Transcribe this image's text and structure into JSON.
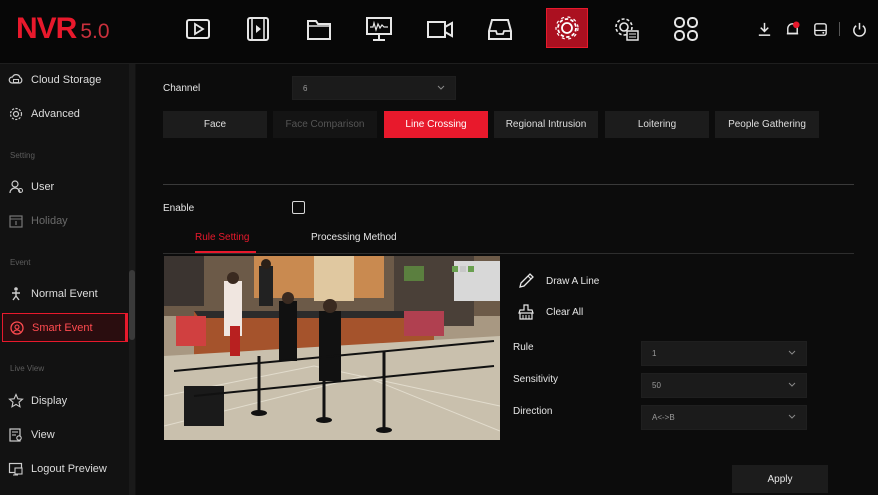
{
  "header": {
    "logo_main": "NVR",
    "logo_version": "5.0",
    "nav_icons": [
      "playback-icon",
      "video-clip-icon",
      "folder-icon",
      "monitor-icon",
      "camera-icon",
      "storage-icon",
      "settings-gear-icon",
      "system-config-icon",
      "grid-menu-icon"
    ],
    "active_nav": "settings-gear-icon",
    "right_icons": [
      "download-icon",
      "alarm-bell-icon",
      "disk-icon",
      "power-icon"
    ]
  },
  "sidebar": {
    "items": [
      {
        "label": "Cloud Storage",
        "icon": "cloud-storage-icon",
        "state": "normal"
      },
      {
        "label": "Advanced",
        "icon": "advanced-gear-icon",
        "state": "normal"
      },
      {
        "label": "User",
        "icon": "user-icon",
        "state": "normal"
      },
      {
        "label": "Holiday",
        "icon": "calendar-icon",
        "state": "dim"
      },
      {
        "label": "Normal Event",
        "icon": "person-walking-icon",
        "state": "normal"
      },
      {
        "label": "Smart Event",
        "icon": "smart-event-icon",
        "state": "active"
      },
      {
        "label": "Display",
        "icon": "star-icon",
        "state": "normal"
      },
      {
        "label": "View",
        "icon": "view-icon",
        "state": "normal"
      },
      {
        "label": "Logout Preview",
        "icon": "logout-preview-icon",
        "state": "normal"
      }
    ],
    "sections": {
      "setting": "Setting",
      "event": "Event",
      "live_view": "Live View"
    }
  },
  "main": {
    "channel_label": "Channel",
    "channel_value": "6",
    "tabs": [
      {
        "label": "Face",
        "state": "normal"
      },
      {
        "label": "Face Comparison",
        "state": "disabled"
      },
      {
        "label": "Line Crossing",
        "state": "active"
      },
      {
        "label": "Regional Intrusion",
        "state": "normal"
      },
      {
        "label": "Loitering",
        "state": "normal"
      },
      {
        "label": "People Gathering",
        "state": "normal"
      }
    ],
    "enable_label": "Enable",
    "enable_checked": false,
    "subtabs": {
      "rule_setting": "Rule Setting",
      "processing_method": "Processing Method"
    },
    "tools": {
      "draw_line": "Draw A Line",
      "clear_all": "Clear All"
    },
    "fields": {
      "rule_label": "Rule",
      "rule_value": "1",
      "sensitivity_label": "Sensitivity",
      "sensitivity_value": "50",
      "direction_label": "Direction",
      "direction_value": "A<->B"
    },
    "apply_label": "Apply"
  },
  "colors": {
    "accent": "#e8192c",
    "background": "#0c0c0c",
    "panel": "#1c1c1c"
  }
}
